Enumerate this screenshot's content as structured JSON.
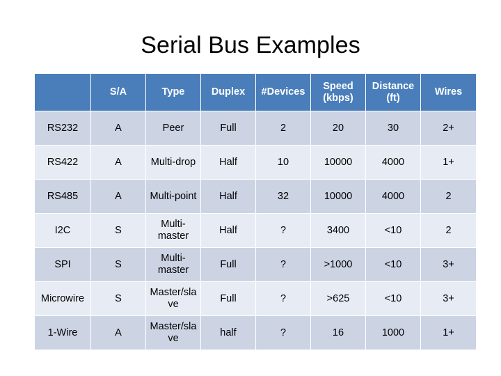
{
  "slide": {
    "title": "Serial Bus Examples",
    "background_color": "#FFFFFF"
  },
  "table": {
    "header_bg": "#4A7EBB",
    "header_text_color": "#FFFFFF",
    "row_dark_bg": "#CCD4E4",
    "row_light_bg": "#E7ECF4",
    "columns": [
      "",
      "S/A",
      "Type",
      "Duplex",
      "#Devices",
      "Speed (kbps)",
      "Distance (ft)",
      "Wires"
    ],
    "rows": [
      {
        "name": "RS232",
        "sa": "A",
        "type": "Peer",
        "duplex": "Full",
        "devices": "2",
        "speed": "20",
        "distance": "30",
        "wires": "2+"
      },
      {
        "name": "RS422",
        "sa": "A",
        "type": "Multi-drop",
        "duplex": "Half",
        "devices": "10",
        "speed": "10000",
        "distance": "4000",
        "wires": "1+"
      },
      {
        "name": "RS485",
        "sa": "A",
        "type": "Multi-point",
        "duplex": "Half",
        "devices": "32",
        "speed": "10000",
        "distance": "4000",
        "wires": "2"
      },
      {
        "name": "I2C",
        "sa": "S",
        "type": "Multi-master",
        "duplex": "Half",
        "devices": "?",
        "speed": "3400",
        "distance": "<10",
        "wires": "2"
      },
      {
        "name": "SPI",
        "sa": "S",
        "type": "Multi-master",
        "duplex": "Full",
        "devices": "?",
        "speed": ">1000",
        "distance": "<10",
        "wires": "3+"
      },
      {
        "name": "Microwire",
        "sa": "S",
        "type": "Master/slave",
        "duplex": "Full",
        "devices": "?",
        "speed": ">625",
        "distance": "<10",
        "wires": "3+"
      },
      {
        "name": "1-Wire",
        "sa": "A",
        "type": "Master/slave",
        "duplex": "half",
        "devices": "?",
        "speed": "16",
        "distance": "1000",
        "wires": "1+"
      }
    ]
  }
}
